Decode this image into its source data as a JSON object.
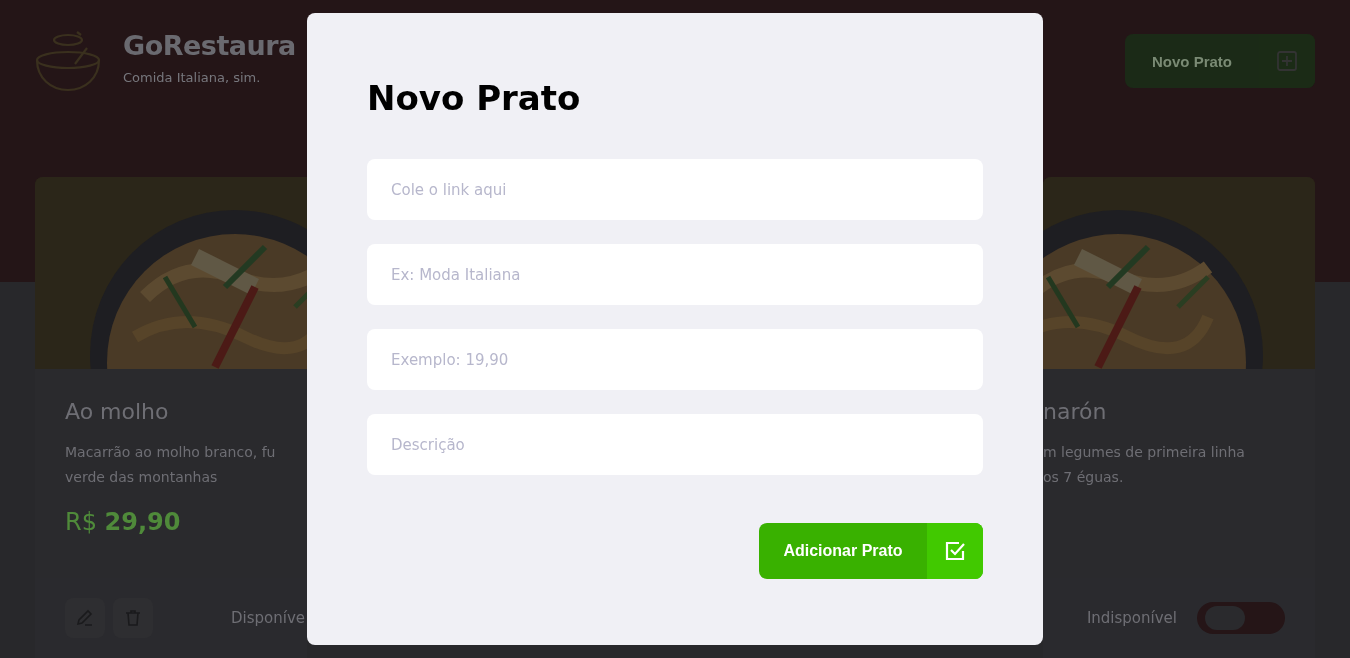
{
  "header": {
    "title": "GoRestaura",
    "subtitle": "Comida Italiana, sim.",
    "new_button": "Novo Prato"
  },
  "cards": [
    {
      "title": "Ao molho",
      "description": [
        "Macarrão ao molho branco, fu",
        "verde das montanhas"
      ],
      "price_currency": "R$",
      "price_value": "29,90",
      "status": "Disponíve"
    },
    {
      "title": "narón",
      "description": [
        "m legumes de primeira linha",
        "os 7 éguas."
      ],
      "status": "Indisponível",
      "available": false
    }
  ],
  "modal": {
    "title": "Novo Prato",
    "fields": [
      {
        "placeholder": "Cole o link aqui"
      },
      {
        "placeholder": "Ex: Moda Italiana"
      },
      {
        "placeholder": "Exemplo: 19,90"
      },
      {
        "placeholder": "Descrição"
      }
    ],
    "submit": "Adicionar Prato"
  }
}
